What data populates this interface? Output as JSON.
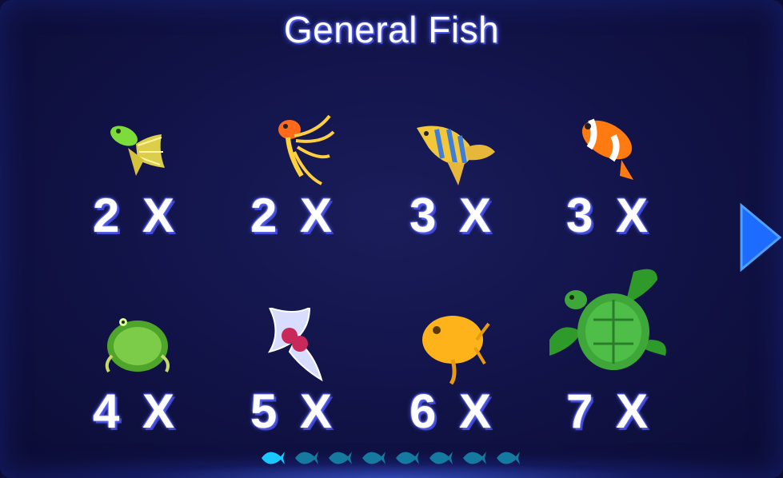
{
  "title": "General Fish",
  "fish": [
    {
      "name": "green-guppy",
      "multiplier": "2 X"
    },
    {
      "name": "goldfish",
      "multiplier": "2 X"
    },
    {
      "name": "angelfish",
      "multiplier": "3 X"
    },
    {
      "name": "clownfish",
      "multiplier": "3 X"
    },
    {
      "name": "green-pufferfish",
      "multiplier": "4 X"
    },
    {
      "name": "crystal-butterfly",
      "multiplier": "5 X"
    },
    {
      "name": "orange-boxfish",
      "multiplier": "6 X"
    },
    {
      "name": "sea-turtle",
      "multiplier": "7 X"
    }
  ],
  "pager": {
    "total_pages": 8,
    "current_page": 1
  },
  "colors": {
    "accent": "#1e6bff",
    "page_active": "#18c8ff",
    "page_inactive": "#147aa0"
  }
}
